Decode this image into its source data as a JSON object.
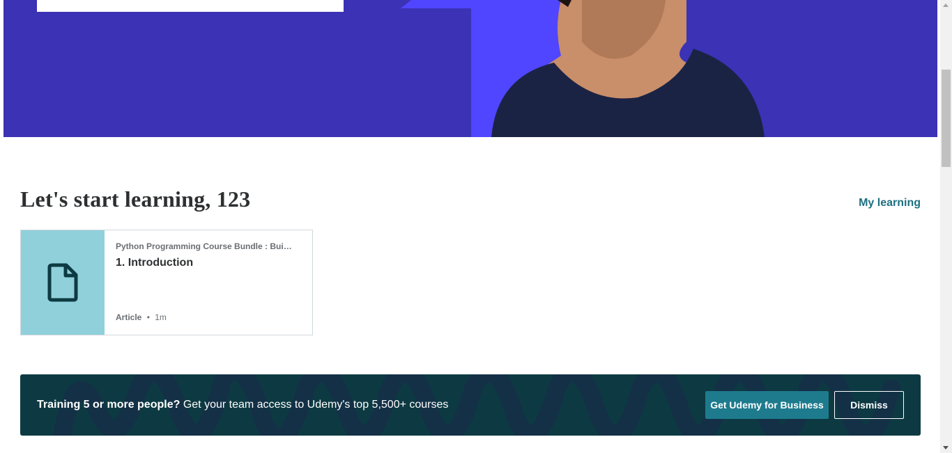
{
  "hero": {
    "background_color": "#3b32b5",
    "accent_color": "#5046ff"
  },
  "learning": {
    "title": "Let's start learning, 123",
    "my_learning_link": "My learning"
  },
  "course_card": {
    "thumbnail_icon": "document-icon",
    "thumbnail_color": "#8fd0db",
    "parent_course": "Python Programming Course Bundle : Build...",
    "lecture_title": "1. Introduction",
    "lecture_type": "Article",
    "separator": "•",
    "duration": "1m"
  },
  "business_banner": {
    "headline": "Training 5 or more people?",
    "description": "Get your team access to Udemy's top 5,500+ courses",
    "primary_button": "Get Udemy for Business",
    "secondary_button": "Dismiss",
    "background_color": "#0d3a42",
    "button_color": "#1e7b8e"
  }
}
